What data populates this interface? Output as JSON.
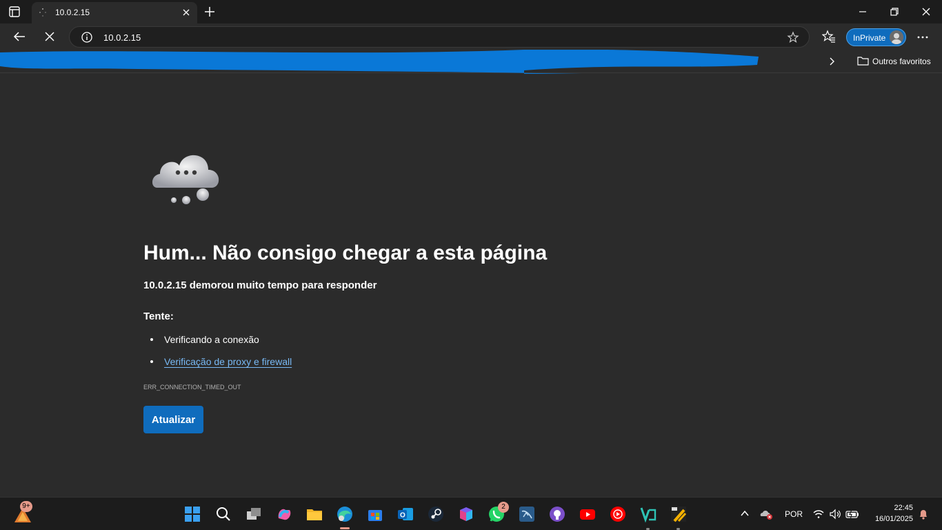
{
  "browser": {
    "tab": {
      "title": "10.0.2.15"
    },
    "address": {
      "url": "10.0.2.15"
    },
    "profile": {
      "label": "InPrivate"
    },
    "favorites_bar": {
      "other_favorites": "Outros favoritos"
    }
  },
  "page": {
    "heading": "Hum... Não consigo chegar a esta página",
    "subheading": "10.0.2.15 demorou muito tempo para responder",
    "try_label": "Tente:",
    "suggestions": [
      "Verificando a conexão",
      "Verificação de proxy e firewall"
    ],
    "error_code": "ERR_CONNECTION_TIMED_OUT",
    "refresh_button": "Atualizar"
  },
  "taskbar": {
    "weather_badge": "9+",
    "whatsapp_badge": "2",
    "language": "POR",
    "time": "22:45",
    "date": "16/01/2025"
  },
  "colors": {
    "accent": "#0f6cbd",
    "link": "#78b9f5",
    "background": "#2b2b2b",
    "redaction": "#0a78d7"
  }
}
